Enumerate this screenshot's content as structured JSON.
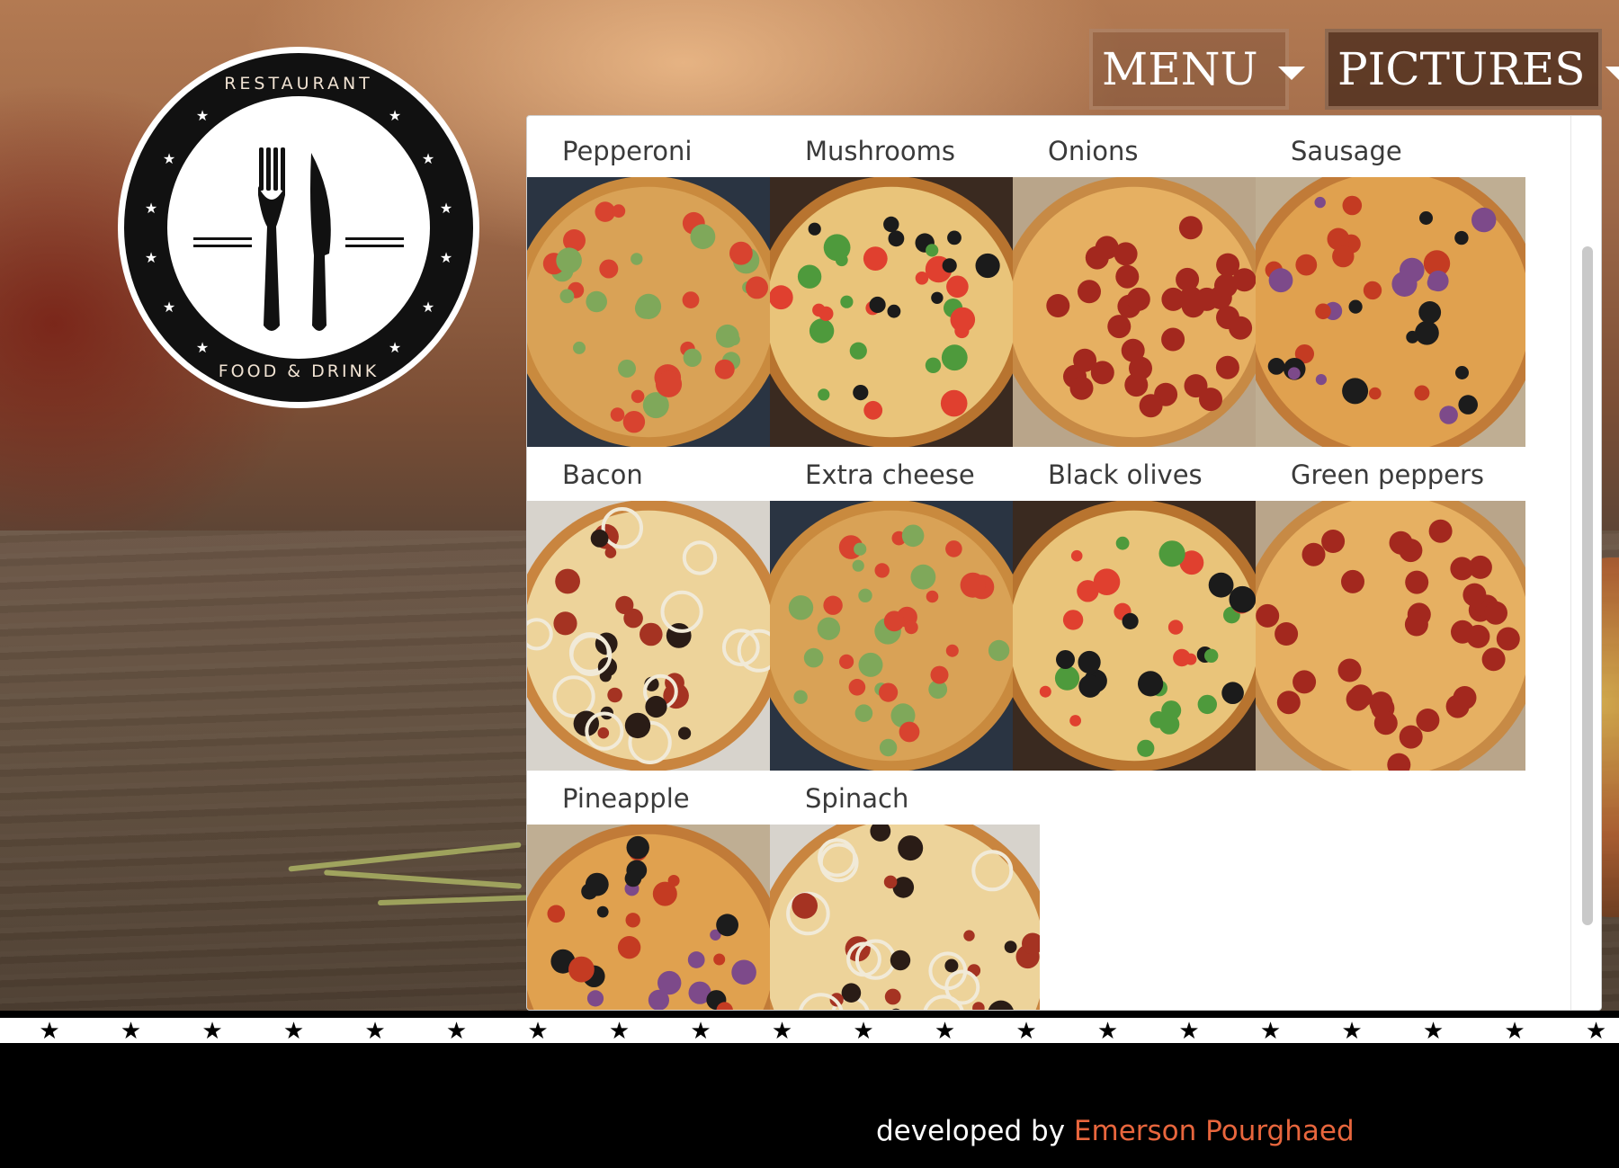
{
  "logo": {
    "top_text": "RESTAURANT",
    "bottom_text": "FOOD & DRINK",
    "icon": "fork-knife-icon"
  },
  "nav": {
    "menu_label": "MENU",
    "pictures_label": "PICTURES"
  },
  "pictures_dropdown": {
    "items": [
      {
        "label": "Pepperoni",
        "pizza": "veggie-zucchini"
      },
      {
        "label": "Mushrooms",
        "pizza": "tomato-olive"
      },
      {
        "label": "Onions",
        "pizza": "pepperoni"
      },
      {
        "label": "Sausage",
        "pizza": "loaded-sliced"
      },
      {
        "label": "Bacon",
        "pizza": "onion-olive"
      },
      {
        "label": "Extra cheese",
        "pizza": "veggie-zucchini"
      },
      {
        "label": "Black olives",
        "pizza": "tomato-olive"
      },
      {
        "label": "Green peppers",
        "pizza": "pepperoni"
      },
      {
        "label": "Pineapple",
        "pizza": "loaded-sliced"
      },
      {
        "label": "Spinach",
        "pizza": "onion-olive"
      }
    ]
  },
  "footer": {
    "prefix": "developed by",
    "author": "Emerson Pourghaed",
    "author_color": "#e8663d"
  }
}
